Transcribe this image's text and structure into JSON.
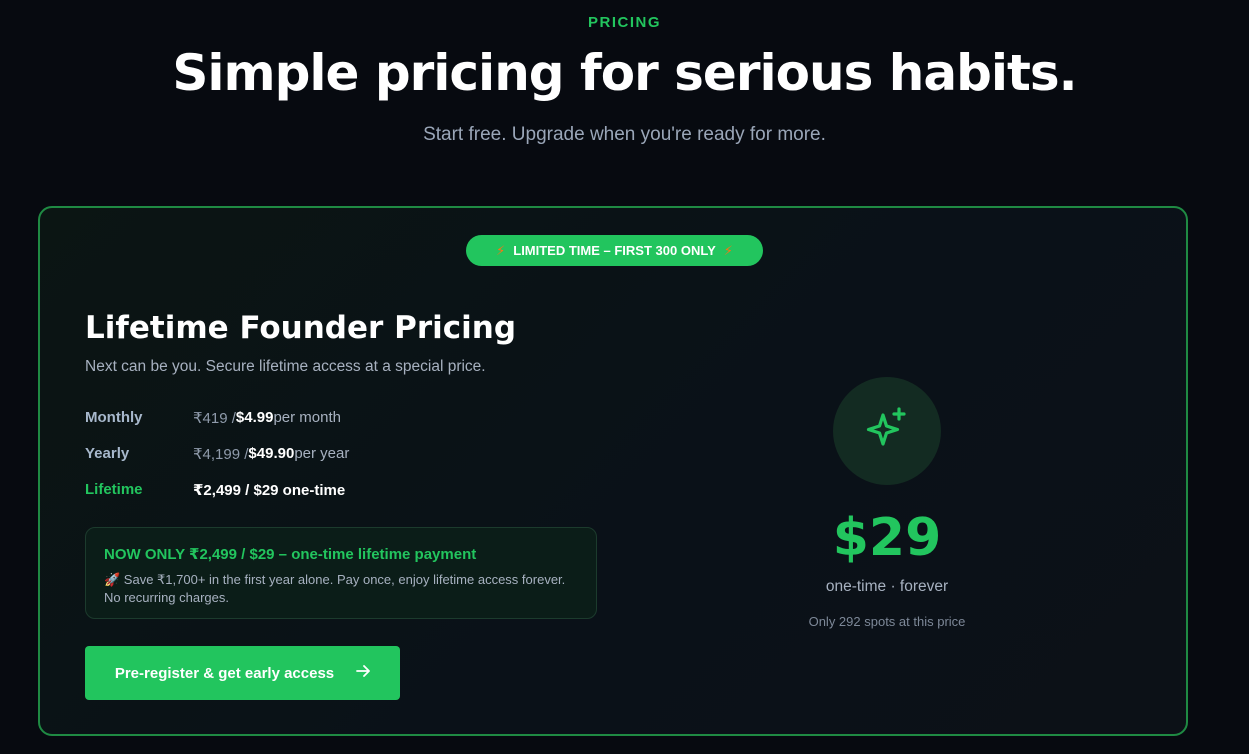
{
  "header": {
    "eyebrow": "PRICING",
    "headline": "Simple pricing for serious habits.",
    "subhead": "Start free. Upgrade when you're ready for more."
  },
  "card": {
    "badge": {
      "text": "LIMITED TIME – FIRST 300 ONLY",
      "icon": "lightning-icon"
    },
    "title": "Lifetime Founder Pricing",
    "subtitle": "Next can be you. Secure lifetime access at a special price.",
    "plans": [
      {
        "name": "Monthly",
        "old_price": "₹419 / ",
        "price": "$4.99",
        "unit": " per month"
      },
      {
        "name": "Yearly",
        "old_price": "₹4,199 / ",
        "price": "$49.90",
        "unit": " per year"
      },
      {
        "name": "Lifetime",
        "price": "₹2,499 / $29 one-time"
      }
    ],
    "offer": {
      "title": "NOW ONLY ₹2,499 / $29 – one-time lifetime payment",
      "description": "🚀 Save ₹1,700+ in the first year alone. Pay once, enjoy lifetime access forever. No recurring charges."
    },
    "cta": {
      "label": "Pre-register & get early access",
      "icon": "arrow-right-icon"
    },
    "summary": {
      "icon": "sparkle-icon",
      "price": "$29",
      "note": "one-time · forever",
      "spots": "Only 292 spots at this price"
    }
  },
  "colors": {
    "background": "#070a10",
    "accent": "#22c55e",
    "card_border": "#1f8a43",
    "bolt": "#f97316"
  }
}
